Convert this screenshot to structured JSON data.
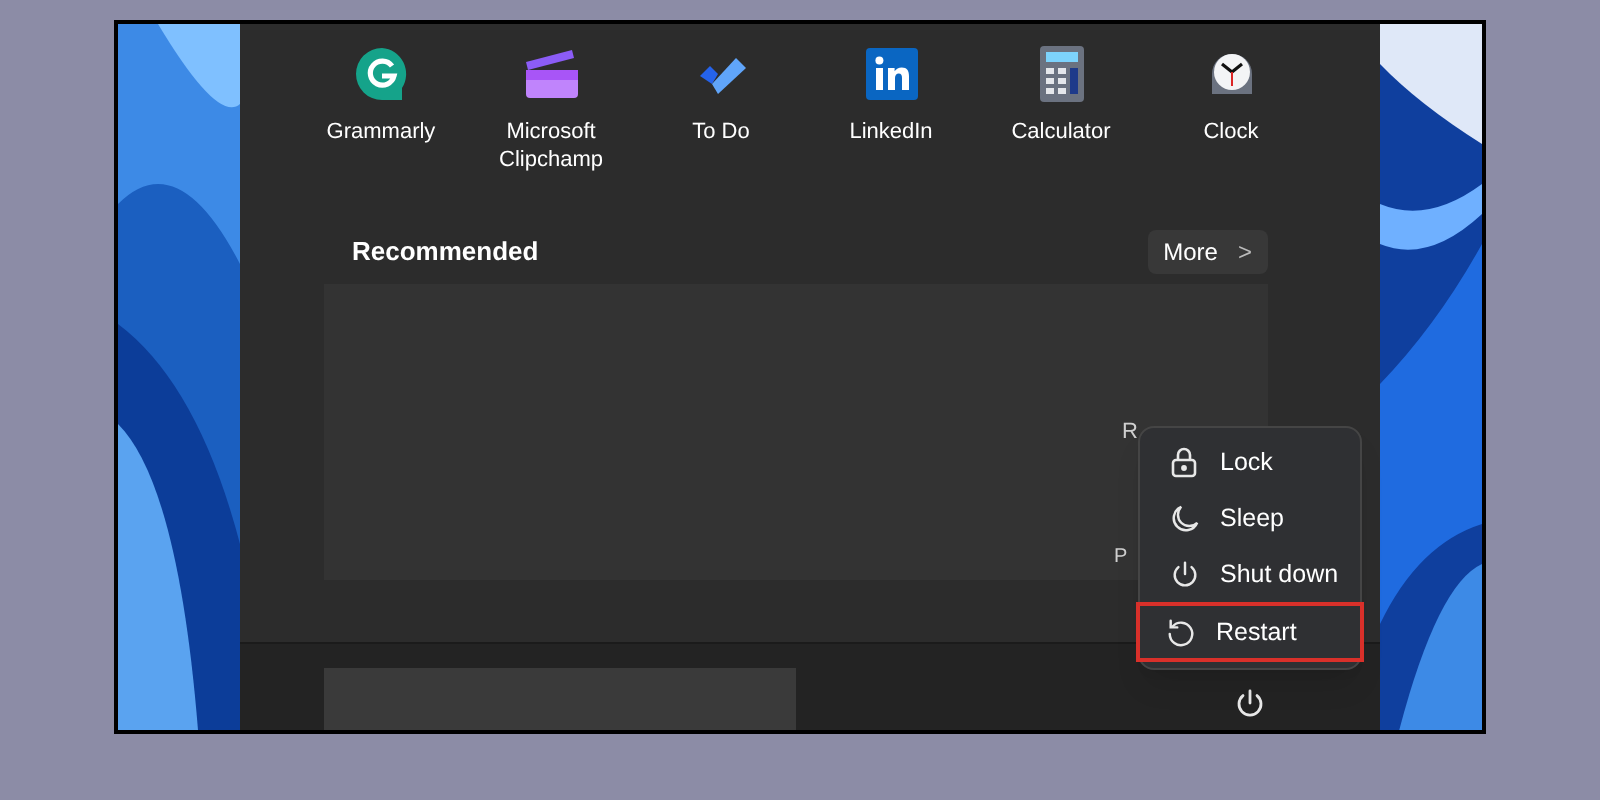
{
  "pinned_apps": [
    {
      "label": "Grammarly",
      "kind": "grammarly"
    },
    {
      "label": "Microsoft\nClipchamp",
      "kind": "clipchamp"
    },
    {
      "label": "To Do",
      "kind": "todo"
    },
    {
      "label": "LinkedIn",
      "kind": "linkedin"
    },
    {
      "label": "Calculator",
      "kind": "calculator"
    },
    {
      "label": "Clock",
      "kind": "clock"
    }
  ],
  "recommended": {
    "title": "Recommended",
    "more_button": {
      "label": "More",
      "icon": ">"
    },
    "partial_texts": [
      "R",
      "P"
    ]
  },
  "power_menu": {
    "items": [
      {
        "label": "Lock",
        "kind": "lock",
        "selected": false
      },
      {
        "label": "Sleep",
        "kind": "sleep",
        "selected": false
      },
      {
        "label": "Shut down",
        "kind": "power",
        "selected": false
      },
      {
        "label": "Restart",
        "kind": "restart",
        "selected": true
      }
    ]
  }
}
